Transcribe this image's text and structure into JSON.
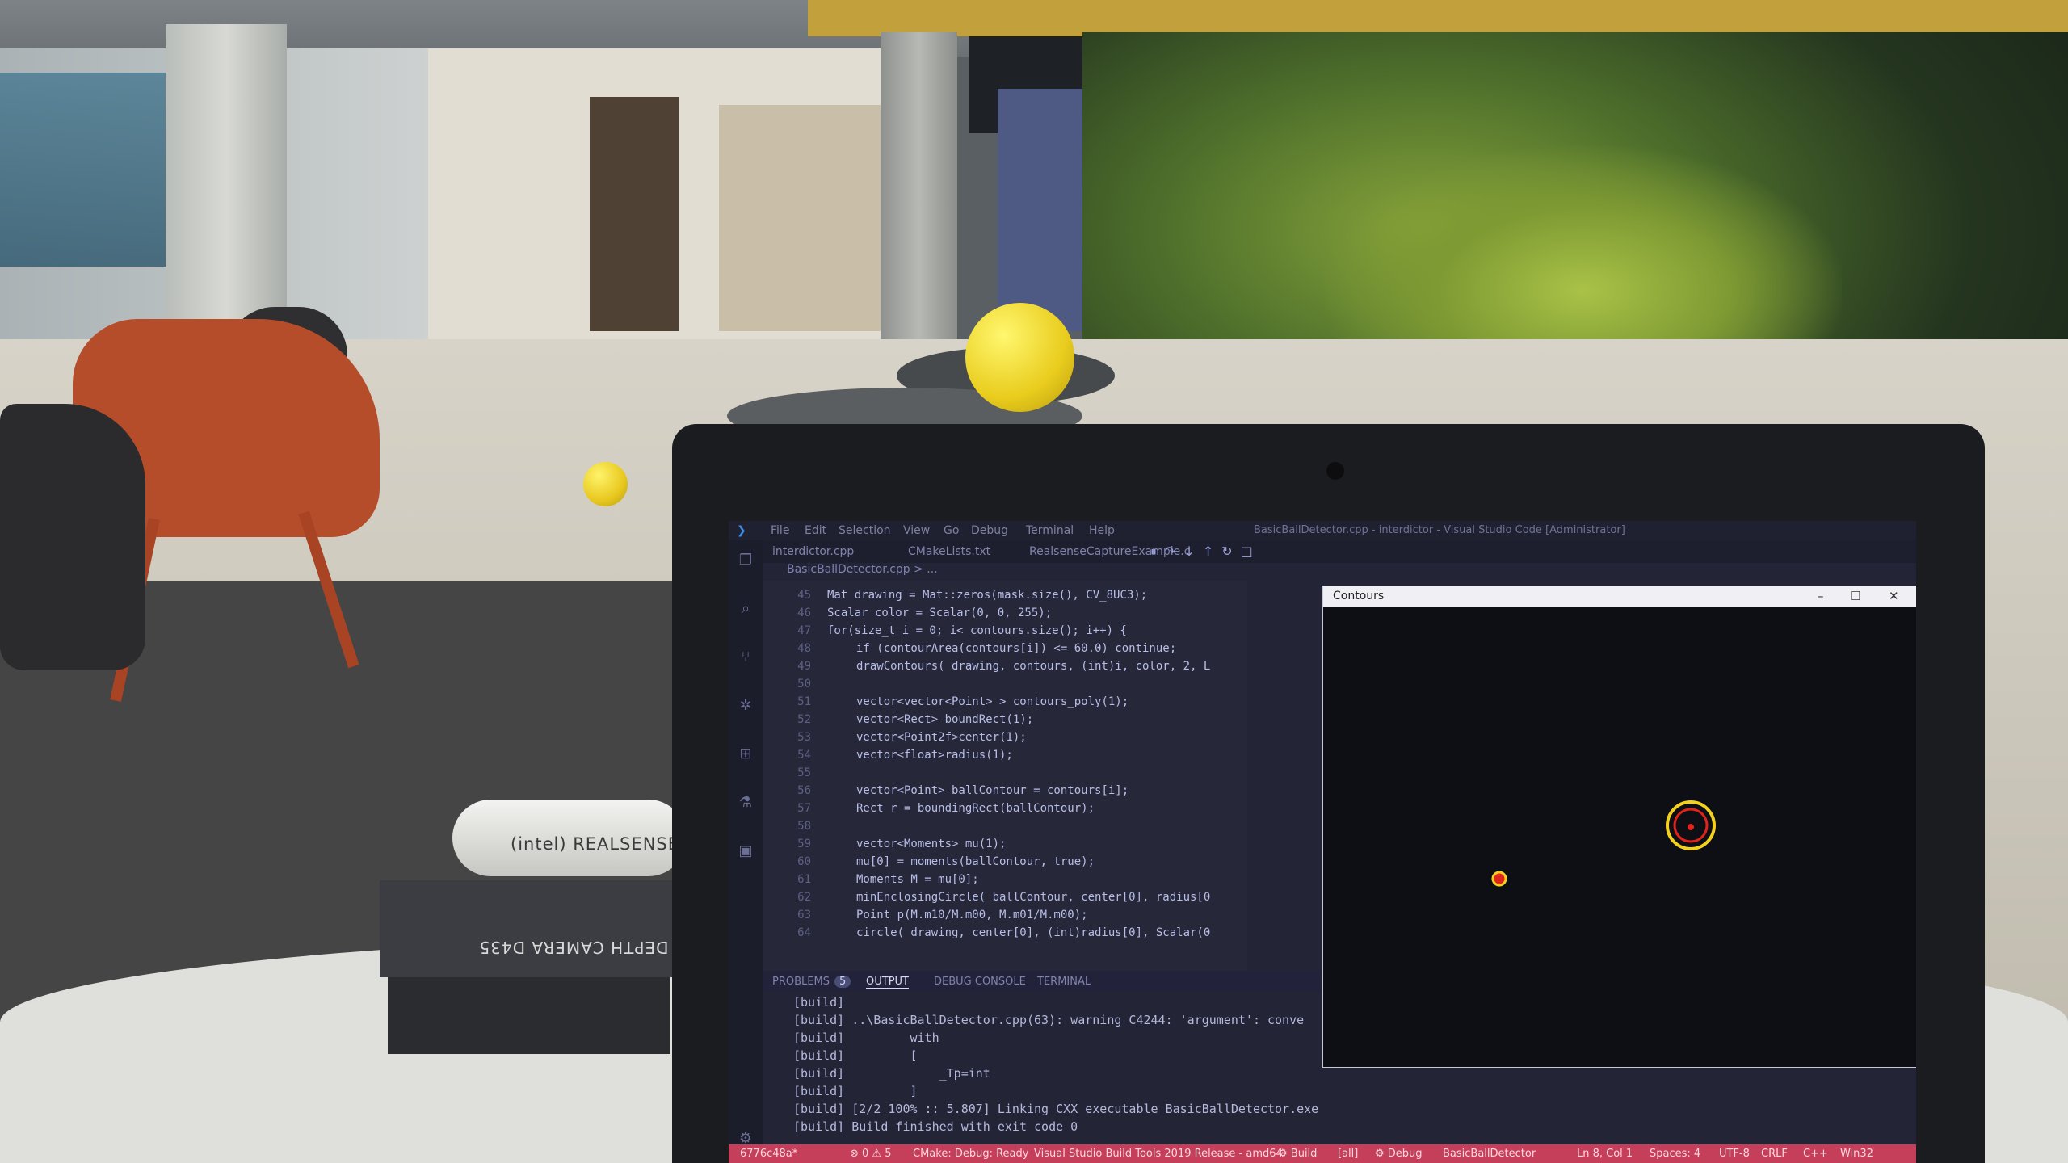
{
  "photo": {
    "camera_label": "(intel) REALSENSE",
    "box_label": "DEPTH CAMERA D435"
  },
  "vscode": {
    "menu": [
      "File",
      "Edit",
      "Selection",
      "View",
      "Go",
      "Debug",
      "Terminal",
      "Help"
    ],
    "window_title": "BasicBallDetector.cpp - interdictor - Visual Studio Code [Administrator]",
    "tabs": [
      "interdictor.cpp",
      "CMakeLists.txt",
      "RealsenseCaptureExample.c"
    ],
    "breadcrumb": "BasicBallDetector.cpp > ...",
    "code_lines": [
      {
        "n": "45",
        "text": "Mat drawing = Mat::zeros(mask.size(), CV_8UC3);",
        "indent": 0
      },
      {
        "n": "46",
        "text": "Scalar color = Scalar(0, 0, 255);",
        "indent": 0
      },
      {
        "n": "47",
        "text": "for(size_t i = 0; i< contours.size(); i++) {",
        "indent": 0
      },
      {
        "n": "48",
        "text": "if (contourArea(contours[i]) <= 60.0) continue;",
        "indent": 1
      },
      {
        "n": "49",
        "text": "drawContours( drawing, contours, (int)i, color, 2, L",
        "indent": 1
      },
      {
        "n": "50",
        "text": "",
        "indent": 1
      },
      {
        "n": "51",
        "text": "vector<vector<Point> > contours_poly(1);",
        "indent": 1
      },
      {
        "n": "52",
        "text": "vector<Rect> boundRect(1);",
        "indent": 1
      },
      {
        "n": "53",
        "text": "vector<Point2f>center(1);",
        "indent": 1
      },
      {
        "n": "54",
        "text": "vector<float>radius(1);",
        "indent": 1
      },
      {
        "n": "55",
        "text": "",
        "indent": 1
      },
      {
        "n": "56",
        "text": "vector<Point> ballContour = contours[i];",
        "indent": 1
      },
      {
        "n": "57",
        "text": "Rect r = boundingRect(ballContour);",
        "indent": 1
      },
      {
        "n": "58",
        "text": "",
        "indent": 1
      },
      {
        "n": "59",
        "text": "vector<Moments> mu(1);",
        "indent": 1
      },
      {
        "n": "60",
        "text": "mu[0] = moments(ballContour, true);",
        "indent": 1
      },
      {
        "n": "61",
        "text": "Moments M = mu[0];",
        "indent": 1
      },
      {
        "n": "62",
        "text": "minEnclosingCircle( ballContour, center[0], radius[0",
        "indent": 1
      },
      {
        "n": "63",
        "text": "Point p(M.m10/M.m00, M.m01/M.m00);",
        "indent": 1
      },
      {
        "n": "64",
        "text": "circle( drawing, center[0], (int)radius[0], Scalar(0",
        "indent": 1
      }
    ],
    "panel_tabs": {
      "problems": "PROBLEMS",
      "problems_count": "5",
      "output": "OUTPUT",
      "debug_console": "DEBUG CONSOLE",
      "terminal": "TERMINAL"
    },
    "output_lines": [
      "[build]",
      "[build] ..\\BasicBallDetector.cpp(63): warning C4244: 'argument': conve",
      "[build]         with",
      "[build]         [",
      "[build]             _Tp=int",
      "[build]         ]",
      "[build] [2/2 100% :: 5.807] Linking CXX executable BasicBallDetector.exe",
      "[build] Build finished with exit code 0"
    ],
    "status": {
      "branch": "6776c48a*",
      "errors": "⊗ 0 ⚠ 5",
      "cmake": "CMake: Debug: Ready",
      "kit": "Visual Studio Build Tools 2019 Release - amd64",
      "build": "⚙ Build",
      "target": "[all]",
      "debug": "⚙ Debug",
      "launch_target": "BasicBallDetector",
      "position": "Ln 8, Col 1",
      "spaces": "Spaces: 4",
      "encoding": "UTF-8",
      "eol": "CRLF",
      "language": "C++",
      "platform": "Win32"
    }
  },
  "contours_window": {
    "title": "Contours",
    "colors": {
      "ring_yellow": "#f3d21e",
      "ring_red": "#e0241a",
      "background": "#0e0f15"
    }
  },
  "colors": {
    "statusbar": "#c63f5a",
    "editor_bg": "#262839",
    "ball": "#e9cc1d"
  }
}
